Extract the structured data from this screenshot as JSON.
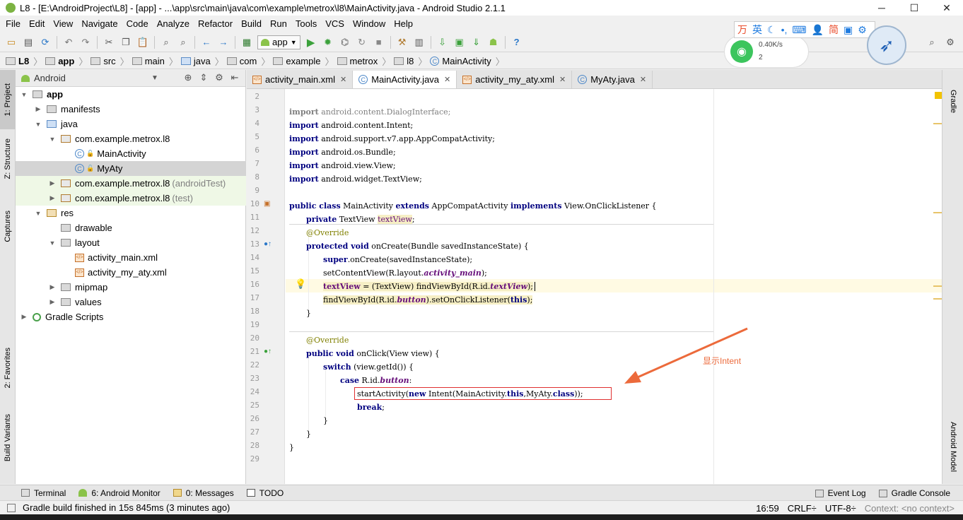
{
  "window": {
    "title": "L8 - [E:\\AndroidProject\\L8] - [app] - ...\\app\\src\\main\\java\\com\\example\\metrox\\l8\\MainActivity.java - Android Studio 2.1.1",
    "minimize": "─",
    "maximize": "☐",
    "close": "✕"
  },
  "menu": [
    "File",
    "Edit",
    "View",
    "Navigate",
    "Code",
    "Analyze",
    "Refactor",
    "Build",
    "Run",
    "Tools",
    "VCS",
    "Window",
    "Help"
  ],
  "toolbar": {
    "run_config": "app",
    "icons": [
      "open-icon",
      "save-icon",
      "sync-icon",
      "undo-icon",
      "redo-icon",
      "cut-icon",
      "copy-icon",
      "paste-icon",
      "find-icon",
      "replace-icon",
      "back-icon",
      "forward-icon",
      "make-icon",
      "run-icon",
      "debug-icon",
      "attach-icon",
      "apply-changes-icon",
      "stop-icon",
      "project-structure-icon",
      "sdk-icon",
      "sync-gradle-icon",
      "avd-icon",
      "sdk-manager-icon",
      "android-icon",
      "help-icon",
      "search-icon",
      "settings-icon"
    ]
  },
  "breadcrumbs": [
    {
      "label": "L8",
      "bold": true
    },
    {
      "label": "app",
      "bold": true
    },
    {
      "label": "src"
    },
    {
      "label": "main"
    },
    {
      "label": "java"
    },
    {
      "label": "com"
    },
    {
      "label": "example"
    },
    {
      "label": "metrox"
    },
    {
      "label": "l8"
    },
    {
      "label": "MainActivity"
    }
  ],
  "tray": {
    "ime": [
      "万",
      "英",
      "☾",
      "•,",
      "⌨",
      "👤",
      "简",
      "▣",
      "⚙"
    ],
    "speed": "0.40K/s",
    "count": "2"
  },
  "left_strip": {
    "project": "1: Project",
    "structure": "Z: Structure",
    "captures": "Captures",
    "favorites": "2: Favorites",
    "build_variants": "Build Variants"
  },
  "right_strip": {
    "gradle": "Gradle",
    "android_model": "Android Model"
  },
  "project_panel": {
    "view": "Android",
    "tree": [
      {
        "label": "app",
        "bold": true,
        "depth": 0,
        "arrow": "▼",
        "icon": "folder"
      },
      {
        "label": "manifests",
        "depth": 1,
        "arrow": "▶",
        "icon": "folder"
      },
      {
        "label": "java",
        "depth": 1,
        "arrow": "▼",
        "icon": "src"
      },
      {
        "label": "com.example.metrox.l8",
        "depth": 2,
        "arrow": "▼",
        "icon": "pkg"
      },
      {
        "label": "MainActivity",
        "depth": 3,
        "arrow": "",
        "icon": "class"
      },
      {
        "label": "MyAty",
        "depth": 3,
        "arrow": "",
        "icon": "class",
        "selected": true
      },
      {
        "label": "com.example.metrox.l8",
        "suffix": "(androidTest)",
        "depth": 2,
        "arrow": "▶",
        "icon": "pkg",
        "green": true
      },
      {
        "label": "com.example.metrox.l8",
        "suffix": "(test)",
        "depth": 2,
        "arrow": "▶",
        "icon": "pkg",
        "green": true
      },
      {
        "label": "res",
        "depth": 1,
        "arrow": "▼",
        "icon": "res"
      },
      {
        "label": "drawable",
        "depth": 2,
        "arrow": "",
        "icon": "folder"
      },
      {
        "label": "layout",
        "depth": 2,
        "arrow": "▼",
        "icon": "folder"
      },
      {
        "label": "activity_main.xml",
        "depth": 3,
        "arrow": "",
        "icon": "xml"
      },
      {
        "label": "activity_my_aty.xml",
        "depth": 3,
        "arrow": "",
        "icon": "xml"
      },
      {
        "label": "mipmap",
        "depth": 2,
        "arrow": "▶",
        "icon": "folder"
      },
      {
        "label": "values",
        "depth": 2,
        "arrow": "▶",
        "icon": "folder"
      },
      {
        "label": "Gradle Scripts",
        "depth": 0,
        "arrow": "▶",
        "icon": "gradle"
      }
    ]
  },
  "editor_tabs": [
    {
      "label": "activity_main.xml",
      "type": "xml",
      "active": false
    },
    {
      "label": "MainActivity.java",
      "type": "class",
      "active": true
    },
    {
      "label": "activity_my_aty.xml",
      "type": "xml",
      "active": false
    },
    {
      "label": "MyAty.java",
      "type": "class",
      "active": false
    }
  ],
  "editor": {
    "line_numbers": [
      "2",
      "3",
      "4",
      "5",
      "6",
      "7",
      "8",
      "9",
      "10",
      "11",
      "12",
      "13",
      "14",
      "15",
      "16",
      "17",
      "18",
      "19",
      "20",
      "21",
      "22",
      "23",
      "24",
      "25",
      "26",
      "27",
      "28",
      "29"
    ],
    "annotation": "显示Intent",
    "lines": {
      "l3_kw": "import",
      "l3_rest": " android.content.DialogInterface;",
      "l4_kw": "import",
      "l4_rest": " android.content.Intent;",
      "l5_kw": "import",
      "l5_rest": " android.support.v7.app.AppCompatActivity;",
      "l6_kw": "import",
      "l6_rest": " android.os.Bundle;",
      "l7_kw": "import",
      "l7_rest": " android.view.View;",
      "l8_kw": "import",
      "l8_rest": " android.widget.TextView;",
      "l10_kw1": "public class",
      "l10_a": " MainActivity ",
      "l10_kw2": "extends",
      "l10_b": " AppCompatActivity ",
      "l10_kw3": "implements",
      "l10_c": " View.OnClickListener {",
      "l11_kw": "private",
      "l11_a": " TextView ",
      "l11_fld": "textView",
      "l11_b": ";",
      "l12_ann": "@Override",
      "l13_kw": "protected void",
      "l13_rest": " onCreate(Bundle savedInstanceState) {",
      "l14_kw": "super",
      "l14_rest": ".onCreate(savedInstanceState);",
      "l15_a": "setContentView(R.layout.",
      "l15_fld": "activity_main",
      "l15_b": ");",
      "l16_fld": "textView",
      "l16_a": " = (TextView) findViewById(R.id.",
      "l16_fld2": "textView",
      "l16_b": ");",
      "l17_a": "findViewById(R.id.",
      "l17_fld": "button",
      "l17_b": ").setOnClickListener(",
      "l17_kw": "this",
      "l17_c": ");",
      "l18": "}",
      "l20_ann": "@Override",
      "l21_kw": "public void",
      "l21_rest": " onClick(View view) {",
      "l22_kw": "switch",
      "l22_rest": " (view.getId()) {",
      "l23_kw": "case",
      "l23_a": " R.id.",
      "l23_fld": "button",
      "l23_b": ":",
      "l24_a": "startActivity(",
      "l24_kw": "new",
      "l24_b": " Intent(MainActivity.",
      "l24_kw2": "this",
      "l24_c": ",MyAty.",
      "l24_kw3": "class",
      "l24_d": "));",
      "l25_kw": "break",
      "l25_rest": ";",
      "l26": "}",
      "l27": "}",
      "l28": "}"
    }
  },
  "bottom_tabs": {
    "terminal": "Terminal",
    "monitor": "6: Android Monitor",
    "messages": "0: Messages",
    "todo": "TODO",
    "event_log": "Event Log",
    "gradle_console": "Gradle Console"
  },
  "status": {
    "message": "Gradle build finished in 15s 845ms (3 minutes ago)",
    "position": "16:59",
    "line_sep": "CRLF÷",
    "encoding": "UTF-8÷",
    "context": "Context: <no context>"
  }
}
